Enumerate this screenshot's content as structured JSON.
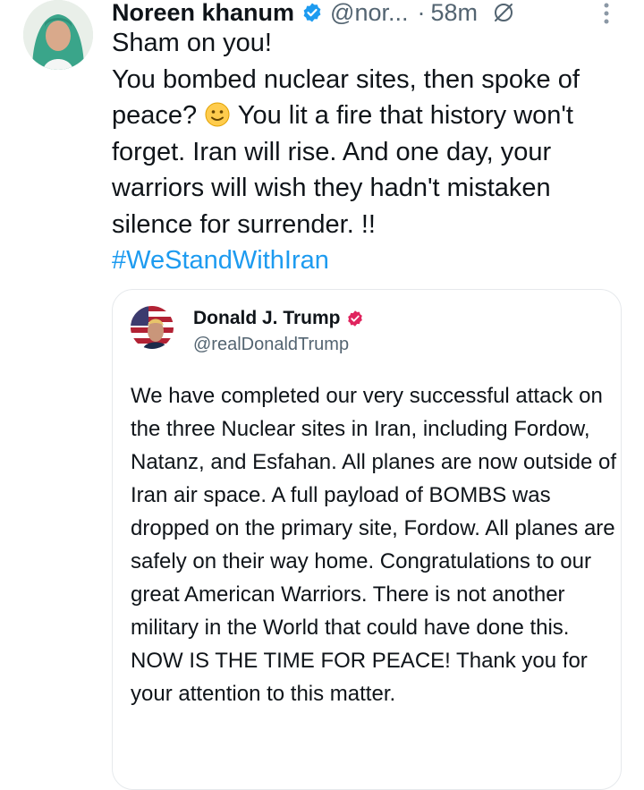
{
  "tweet": {
    "author_name": "Noreen khanum",
    "handle": "@nor...",
    "separator": "·",
    "time": "58m",
    "line1": "Sham on you!",
    "body_before_emoji": "You bombed nuclear sites, then spoke of peace?",
    "body_after_emoji": "You lit a fire that history won't forget. Iran will rise. And one day, your warriors will wish they hadn't mistaken silence for surrender. !!",
    "hashtag": "#WeStandWithIran",
    "colors": {
      "hashtag": "#1d9bf0",
      "verified": "#1d9bf0",
      "muted": "#536471"
    },
    "icons": [
      "verified-badge-icon",
      "grok-icon",
      "more-options-icon",
      "slightly-smiling-face-emoji"
    ]
  },
  "quoted_tweet": {
    "author_name": "Donald J. Trump",
    "handle": "@realDonaldTrump",
    "text": "We have completed our very successful attack on the three Nuclear sites in Iran, including Fordow, Natanz, and Esfahan. All planes are now outside of Iran air space. A full payload of BOMBS was dropped on the primary site, Fordow. All planes are safely on their way home. Congratulations to our great American Warriors. There is not another military in the World that could have done this. NOW IS THE TIME FOR PEACE! Thank you for your attention to this matter.",
    "colors": {
      "badge": "#e0245e"
    },
    "icons": [
      "flag-avatar",
      "verified-badge-icon"
    ]
  }
}
